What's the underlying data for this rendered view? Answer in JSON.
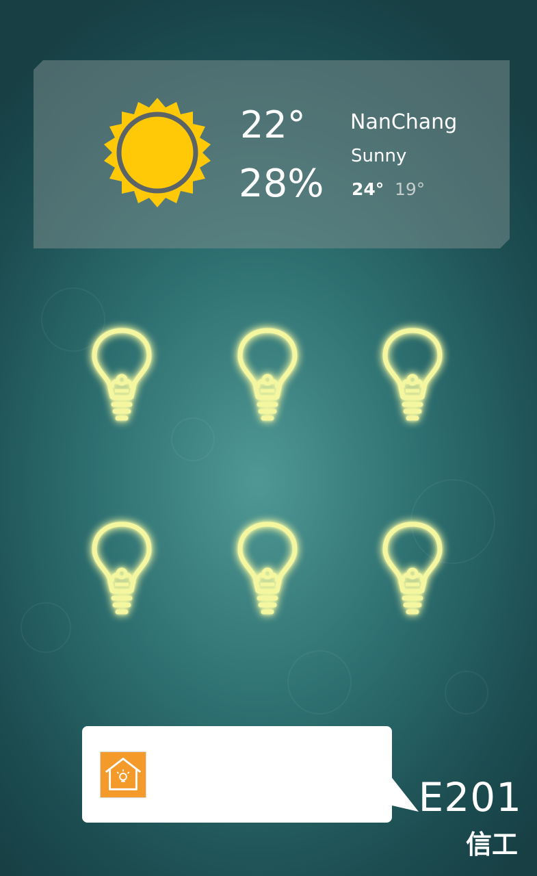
{
  "weather": {
    "icon": "sun-icon",
    "temperature": "22°",
    "humidity": "28%",
    "city": "NanChang",
    "condition": "Sunny",
    "high": "24°",
    "low": "19°"
  },
  "lights": [
    {
      "name": "light-1",
      "state": "on"
    },
    {
      "name": "light-2",
      "state": "on"
    },
    {
      "name": "light-3",
      "state": "on"
    },
    {
      "name": "light-4",
      "state": "on"
    },
    {
      "name": "light-5",
      "state": "on"
    },
    {
      "name": "light-6",
      "state": "on"
    }
  ],
  "footer": {
    "app_icon": "smart-home-icon",
    "room": "E201",
    "building": "信工"
  },
  "colors": {
    "accent_bulb": "#f4f7a0",
    "sun": "#ffc908",
    "app_icon_bg": "#f39a2b"
  }
}
